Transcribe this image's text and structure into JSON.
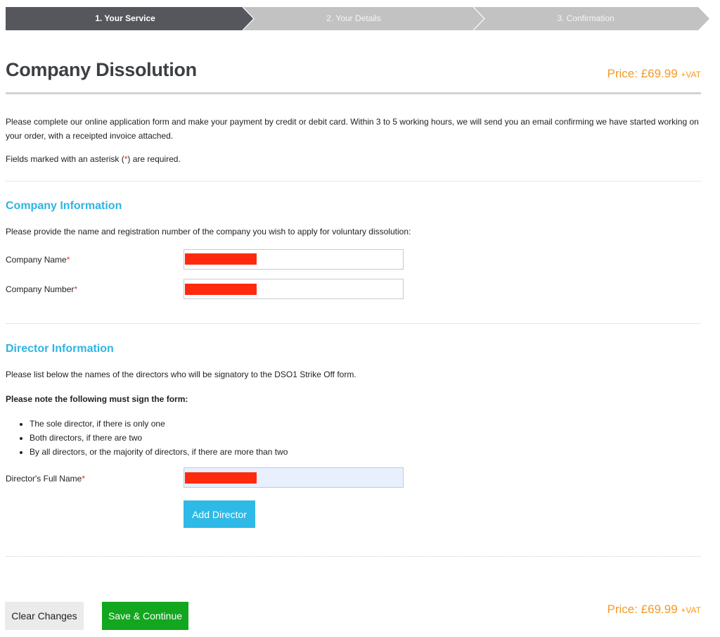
{
  "steps": [
    {
      "label": "1. Your Service",
      "active": true
    },
    {
      "label": "2. Your Details",
      "active": false
    },
    {
      "label": "3. Confirmation",
      "active": false
    }
  ],
  "colors": {
    "step_active": "#55575c",
    "step_inactive": "#c2c2c2",
    "section_heading": "#2fb4e3",
    "price": "#f59a23",
    "add_button": "#2fb9e6",
    "save_button": "#13a61f",
    "required": "#e4312b"
  },
  "header": {
    "title": "Company Dissolution",
    "price_label": "Price: £69.99",
    "vat": "+VAT"
  },
  "intro": {
    "paragraph": "Please complete our online application form and make your payment by credit or debit card. Within 3 to 5 working hours, we will send you an email confirming we have started working on your order, with a receipted invoice attached.",
    "required_before": "Fields marked with an asterisk (",
    "required_mark": "*",
    "required_after": ") are required."
  },
  "company": {
    "heading": "Company Information",
    "description": "Please provide the name and registration number of the company you wish to apply for voluntary dissolution:",
    "name_label": "Company Name",
    "number_label": "Company Number",
    "required_mark": "*"
  },
  "director": {
    "heading": "Director Information",
    "description": "Please list below the names of the directors who will be signatory to the DSO1 Strike Off form.",
    "note": "Please note the following must sign the form:",
    "rules": [
      "The sole director, if there is only one",
      "Both directors, if there are two",
      "By all directors, or the majority of directors, if there are more than two"
    ],
    "name_label": "Director's Full Name",
    "required_mark": "*",
    "add_button": "Add Director"
  },
  "footer": {
    "clear_button": "Clear Changes",
    "save_button": "Save & Continue",
    "price_label": "Price: £69.99",
    "vat": "+VAT"
  }
}
